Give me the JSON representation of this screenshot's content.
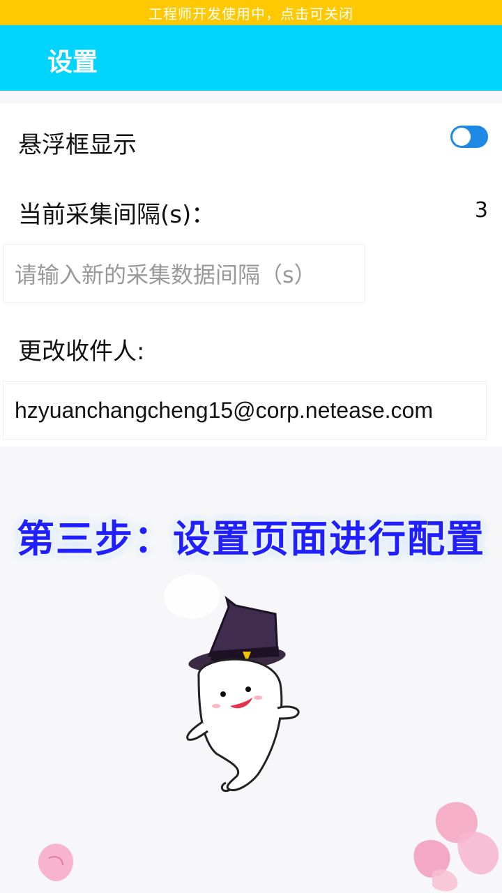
{
  "banner": {
    "text": "工程师开发使用中，点击可关闭"
  },
  "appbar": {
    "title": "设置"
  },
  "settings": {
    "floating_label": "悬浮框显示",
    "floating_enabled": true,
    "interval_label": "当前采集间隔(s)：",
    "interval_value": "3",
    "interval_placeholder": "请输入新的采集数据间隔（s）",
    "recipient_label": "更改收件人:",
    "recipient_value": "hzyuanchangcheng15@corp.netease.com"
  },
  "overlay": {
    "caption": "第三步：设置页面进行配置"
  },
  "colors": {
    "banner": "#ffc800",
    "appbar": "#00d4ff",
    "toggle_on": "#1e88e5",
    "caption": "#1f1fff"
  }
}
